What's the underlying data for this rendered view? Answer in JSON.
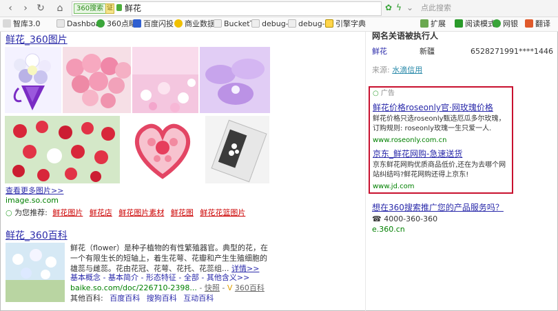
{
  "toolbar": {
    "back": "‹",
    "forward": "›",
    "refresh": "↻",
    "home": "⌂",
    "badge": "360搜索",
    "badge2": "证",
    "address": "鲜花",
    "search_placeholder": "点此搜索"
  },
  "bookmarks": [
    "智库3.0",
    "Dashboa",
    "360点睛",
    "百度闪投",
    "商业数据",
    "BucketT",
    "debug-p",
    "debug-a",
    "引擎字典"
  ],
  "bookmarks_right": [
    "扩展",
    "阅读模式",
    "网银",
    "翻译"
  ],
  "image_result": {
    "title": "鲜花_360图片",
    "more_link": "查看更多图片>>",
    "url": "image.so.com",
    "recommend_label": "为您推荐:",
    "recommend": [
      "鲜花图片",
      "鲜花店",
      "鲜花图片素材",
      "鲜花图",
      "鲜花花篮图片"
    ]
  },
  "baike_result": {
    "title": "鲜花_360百科",
    "desc": "鲜花（flower）是种子植物的有性繁殖器官。典型的花，在一个有限生长的短轴上，着生花萼、花瓣和产生生殖细胞的雄蕊与雌蕊。花由花冠、花萼、花托、花蕊组...",
    "detail_link": "详情>>",
    "sub_links": "基本概念 - 基本简介 - 形态特征 - 全部 - 其他含义>>",
    "url": "baike.so.com/doc/226710-2398...",
    "snapshot": "快照",
    "source": "360百科",
    "other_label": "其他百科:",
    "other_links": [
      "百度百科",
      "搜狗百科",
      "互动百科"
    ]
  },
  "right_panel": {
    "header_cut": "网名关语被执行人",
    "person_name": "鲜花",
    "person_place": "新疆",
    "person_id": "6528271991****1446",
    "source_label": "来源:",
    "source_link": "水滴信用",
    "ad_label": "广告",
    "ads": [
      {
        "title": "鲜花价格roseonly官·网玫瑰价格",
        "text": "鲜花价格只选roseonly甄选厄瓜多尔玫瑰，订购规则: roseonly玫瑰一生只爱一人.",
        "url": "www.roseonly.com.cn"
      },
      {
        "title": "京东_鲜花网购-急速送货",
        "text": "京东鲜花网购优质商品低价,还在为去哪个网站纠结吗?鲜花网购还得上京东!",
        "url": "www.jd.com"
      }
    ],
    "promo_link": "想在360搜索推广您的产品服务吗？",
    "phone": "4000-360-360",
    "promo_url": "e.360.cn"
  },
  "colors": {
    "link": "#2a2aaa",
    "keyword": "#cc0000",
    "url_green": "#008000",
    "ad_border": "#c8102e"
  }
}
